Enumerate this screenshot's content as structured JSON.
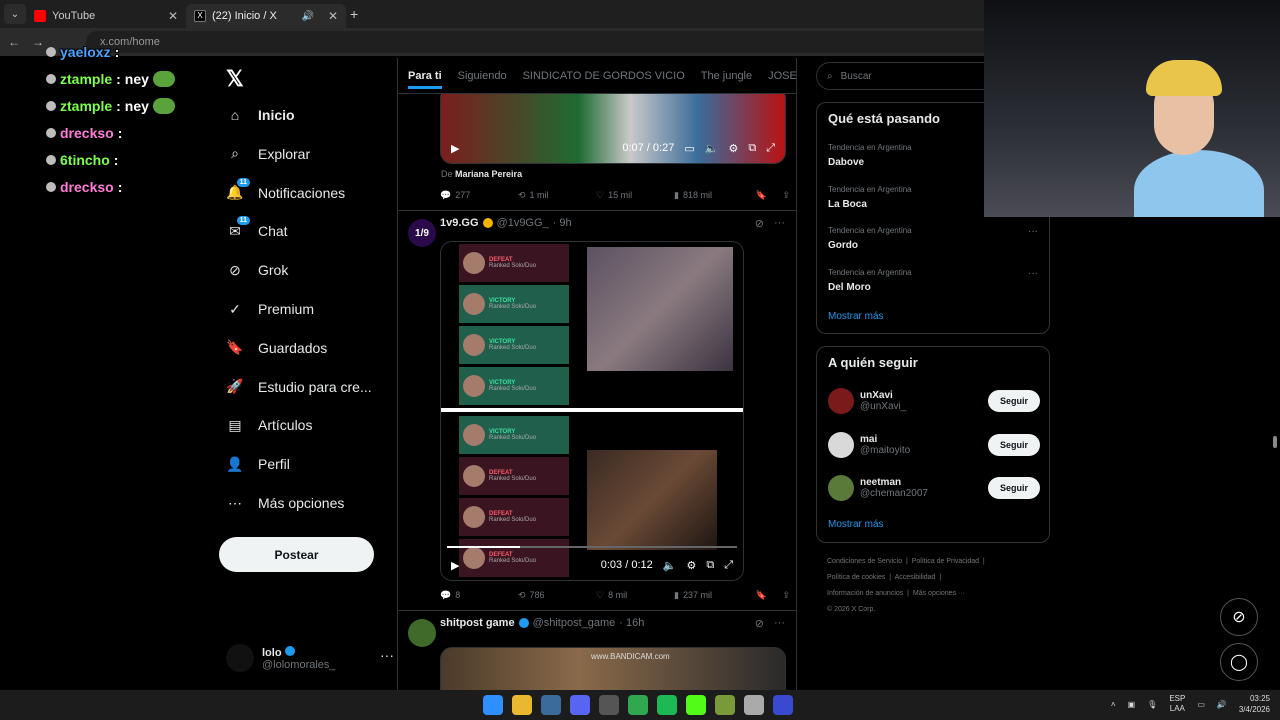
{
  "browser": {
    "tabs": [
      {
        "title": "YouTube",
        "active": false
      },
      {
        "title": "(22) Inicio / X",
        "active": true
      }
    ],
    "url": "x.com/home"
  },
  "stream_chat": [
    {
      "user": "yaeloxz",
      "message": ""
    },
    {
      "user": "ztample",
      "message": "ney"
    },
    {
      "user": "ztample",
      "message": "ney"
    },
    {
      "user": "drecksо",
      "message": ""
    },
    {
      "user": "6tincho",
      "message": ""
    },
    {
      "user": "drecksо",
      "message": ""
    }
  ],
  "nav": {
    "items": [
      {
        "label": "Inicio",
        "icon": "home-icon",
        "badge": ""
      },
      {
        "label": "Explorar",
        "icon": "search-icon",
        "badge": ""
      },
      {
        "label": "Notificaciones",
        "icon": "bell-icon",
        "badge": "11"
      },
      {
        "label": "Chat",
        "icon": "chat-icon",
        "badge": "11"
      },
      {
        "label": "Grok",
        "icon": "grok-icon",
        "badge": ""
      },
      {
        "label": "Premium",
        "icon": "premium-icon",
        "badge": ""
      },
      {
        "label": "Guardados",
        "icon": "bookmark-icon",
        "badge": ""
      },
      {
        "label": "Estudio para cre...",
        "icon": "rocket-icon",
        "badge": ""
      },
      {
        "label": "Artículos",
        "icon": "article-icon",
        "badge": ""
      },
      {
        "label": "Perfil",
        "icon": "person-icon",
        "badge": ""
      },
      {
        "label": "Más opciones",
        "icon": "more-circle-icon",
        "badge": ""
      }
    ],
    "post_button": "Postear",
    "profile": {
      "name": "lolo",
      "handle": "@lolomorales_"
    }
  },
  "feed": {
    "tabs": [
      "Para ti",
      "Siguiendo",
      "SINDICATO DE GORDOS VICIO",
      "The jungle",
      "JOSEO"
    ],
    "post1": {
      "video_time": "0:07 / 0:27",
      "from_label": "De",
      "from_name": "Mariana Pereira",
      "replies": "277",
      "reposts": "1 mil",
      "likes": "15 mil",
      "views": "818 mil"
    },
    "post2": {
      "name": "1v9.GG",
      "handle": "@1v9GG_",
      "time": "· 9h",
      "video_time": "0:03 / 0:12",
      "replies": "8",
      "reposts": "786",
      "likes": "8 mil",
      "views": "237 mil",
      "match_rows": [
        {
          "result": "DEFEAT",
          "queue": "Ranked Solo/Duo"
        },
        {
          "result": "VICTORY",
          "queue": "Ranked Solo/Duo"
        },
        {
          "result": "VICTORY",
          "queue": "Ranked Solo/Duo"
        },
        {
          "result": "VICTORY",
          "queue": "Ranked Solo/Duo"
        },
        {
          "result": "VICTORY",
          "queue": "Ranked Solo/Duo"
        },
        {
          "result": "DEFEAT",
          "queue": "Ranked Solo/Duo"
        },
        {
          "result": "DEFEAT",
          "queue": "Ranked Solo/Duo"
        },
        {
          "result": "DEFEAT",
          "queue": "Ranked Solo/Duo"
        }
      ]
    },
    "post3": {
      "name": "shitpost game",
      "handle": "@shitpost_game",
      "time": "· 16h",
      "media_text": "www.BANDICAM.com"
    }
  },
  "right": {
    "search_placeholder": "Buscar",
    "trends_title": "Qué está pasando",
    "trends": [
      {
        "context": "Tendencia en Argentina",
        "name": "Dabove"
      },
      {
        "context": "Tendencia en Argentina",
        "name": "La Boca"
      },
      {
        "context": "Tendencia en Argentina",
        "name": "Gordo"
      },
      {
        "context": "Tendencia en Argentina",
        "name": "Del Moro"
      }
    ],
    "show_more": "Mostrar más",
    "follow_title": "A quién seguir",
    "follow": [
      {
        "name": "unXavi",
        "handle": "@unXavi_",
        "button": "Seguir"
      },
      {
        "name": "mai",
        "handle": "@maitoyito",
        "button": "Seguir"
      },
      {
        "name": "neetman",
        "handle": "@cheman2007",
        "button": "Seguir"
      }
    ],
    "footer": {
      "terms": "Condiciones de Servicio",
      "privacy": "Política de Privacidad",
      "cookies": "Política de cookies",
      "accessibility": "Accesibilidad",
      "ads": "Información de anuncios",
      "more": "Más opciones ···",
      "copyright": "© 2026 X Corp."
    }
  },
  "taskbar": {
    "lang": "ESP",
    "region": "LAA",
    "time": "03:25",
    "date": "3/4/2026"
  },
  "colors": {
    "accent": "#1d9bf0",
    "victory": "#1f5f4c",
    "defeat": "#3a1420"
  }
}
